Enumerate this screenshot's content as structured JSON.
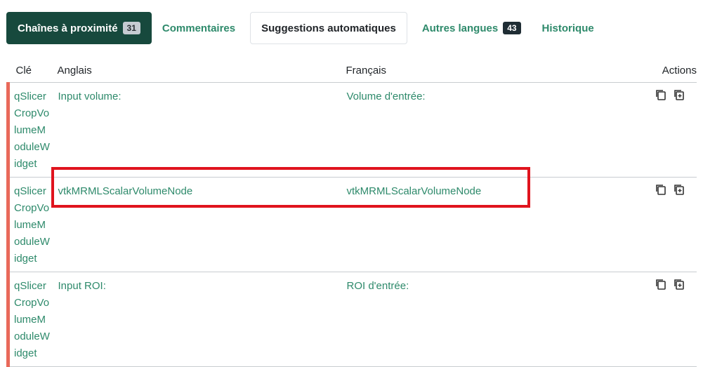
{
  "tabs": [
    {
      "label": "Chaînes à proximité",
      "badge": "31"
    },
    {
      "label": "Commentaires"
    },
    {
      "label": "Suggestions automatiques"
    },
    {
      "label": "Autres langues",
      "badge": "43"
    },
    {
      "label": "Historique"
    }
  ],
  "table": {
    "headers": {
      "key": "Clé",
      "source": "Anglais",
      "target": "Français",
      "actions": "Actions"
    },
    "rows": [
      {
        "key": "qSlicerCropVolumeModuleWidget",
        "source": "Input volume:",
        "target": "Volume d'entrée:"
      },
      {
        "key": "qSlicerCropVolumeModuleWidget",
        "source": "vtkMRMLScalarVolumeNode",
        "target": "vtkMRMLScalarVolumeNode"
      },
      {
        "key": "qSlicerCropVolumeModuleWidget",
        "source": "Input ROI:",
        "target": "ROI d'entrée:"
      }
    ]
  },
  "colors": {
    "accent": "#17493d",
    "link": "#2e8a6b",
    "row_marker": "#e9695a",
    "highlight": "#e0141e"
  },
  "icons": {
    "copy": "copy-icon",
    "clone": "clone-icon"
  }
}
